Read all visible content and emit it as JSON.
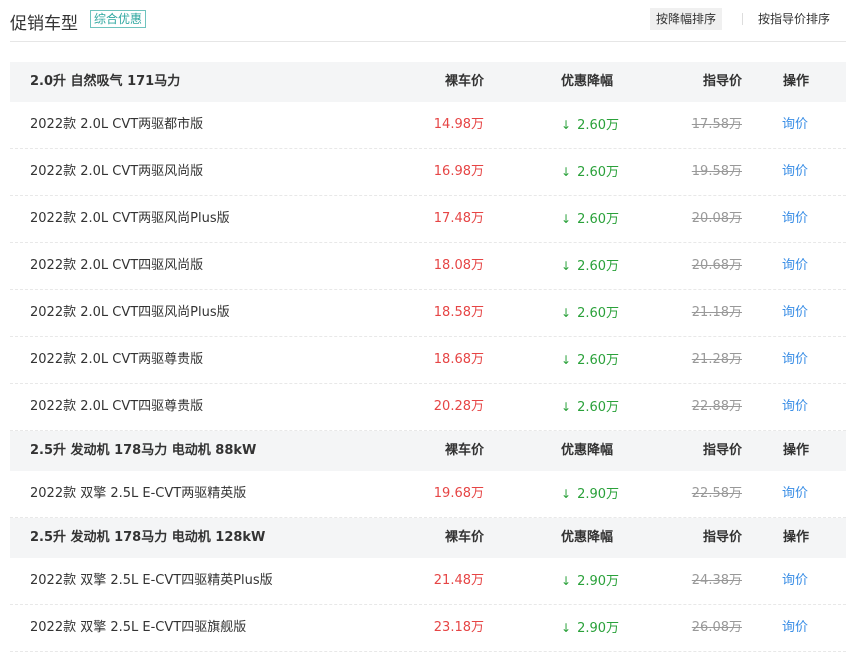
{
  "header": {
    "title": "促销车型",
    "tag": "综合优惠",
    "sort_by_discount": "按降幅排序",
    "sort_by_guide": "按指导价排序"
  },
  "columns": {
    "price": "裸车价",
    "discount": "优惠降幅",
    "guide": "指导价",
    "action": "操作"
  },
  "groups": [
    {
      "title": "2.0升 自然吸气 171马力",
      "rows": [
        {
          "name": "2022款 2.0L CVT两驱都市版",
          "price": "14.98万",
          "discount": "2.60万",
          "guide": "17.58万",
          "action": "询价"
        },
        {
          "name": "2022款 2.0L CVT两驱风尚版",
          "price": "16.98万",
          "discount": "2.60万",
          "guide": "19.58万",
          "action": "询价"
        },
        {
          "name": "2022款 2.0L CVT两驱风尚Plus版",
          "price": "17.48万",
          "discount": "2.60万",
          "guide": "20.08万",
          "action": "询价"
        },
        {
          "name": "2022款 2.0L CVT四驱风尚版",
          "price": "18.08万",
          "discount": "2.60万",
          "guide": "20.68万",
          "action": "询价"
        },
        {
          "name": "2022款 2.0L CVT四驱风尚Plus版",
          "price": "18.58万",
          "discount": "2.60万",
          "guide": "21.18万",
          "action": "询价"
        },
        {
          "name": "2022款 2.0L CVT两驱尊贵版",
          "price": "18.68万",
          "discount": "2.60万",
          "guide": "21.28万",
          "action": "询价"
        },
        {
          "name": "2022款 2.0L CVT四驱尊贵版",
          "price": "20.28万",
          "discount": "2.60万",
          "guide": "22.88万",
          "action": "询价"
        }
      ]
    },
    {
      "title": "2.5升 发动机 178马力 电动机 88kW",
      "rows": [
        {
          "name": "2022款 双擎 2.5L E-CVT两驱精英版",
          "price": "19.68万",
          "discount": "2.90万",
          "guide": "22.58万",
          "action": "询价"
        }
      ]
    },
    {
      "title": "2.5升 发动机 178马力 电动机 128kW",
      "rows": [
        {
          "name": "2022款 双擎 2.5L E-CVT四驱精英Plus版",
          "price": "21.48万",
          "discount": "2.90万",
          "guide": "24.38万",
          "action": "询价"
        },
        {
          "name": "2022款 双擎 2.5L E-CVT四驱旗舰版",
          "price": "23.18万",
          "discount": "2.90万",
          "guide": "26.08万",
          "action": "询价"
        }
      ]
    }
  ],
  "icons": {
    "discount_arrow": "arrow-down-icon"
  },
  "colors": {
    "price": "#e64545",
    "discount": "#2aa13a",
    "link": "#3a8ee6",
    "tag": "#2fa7a0"
  }
}
